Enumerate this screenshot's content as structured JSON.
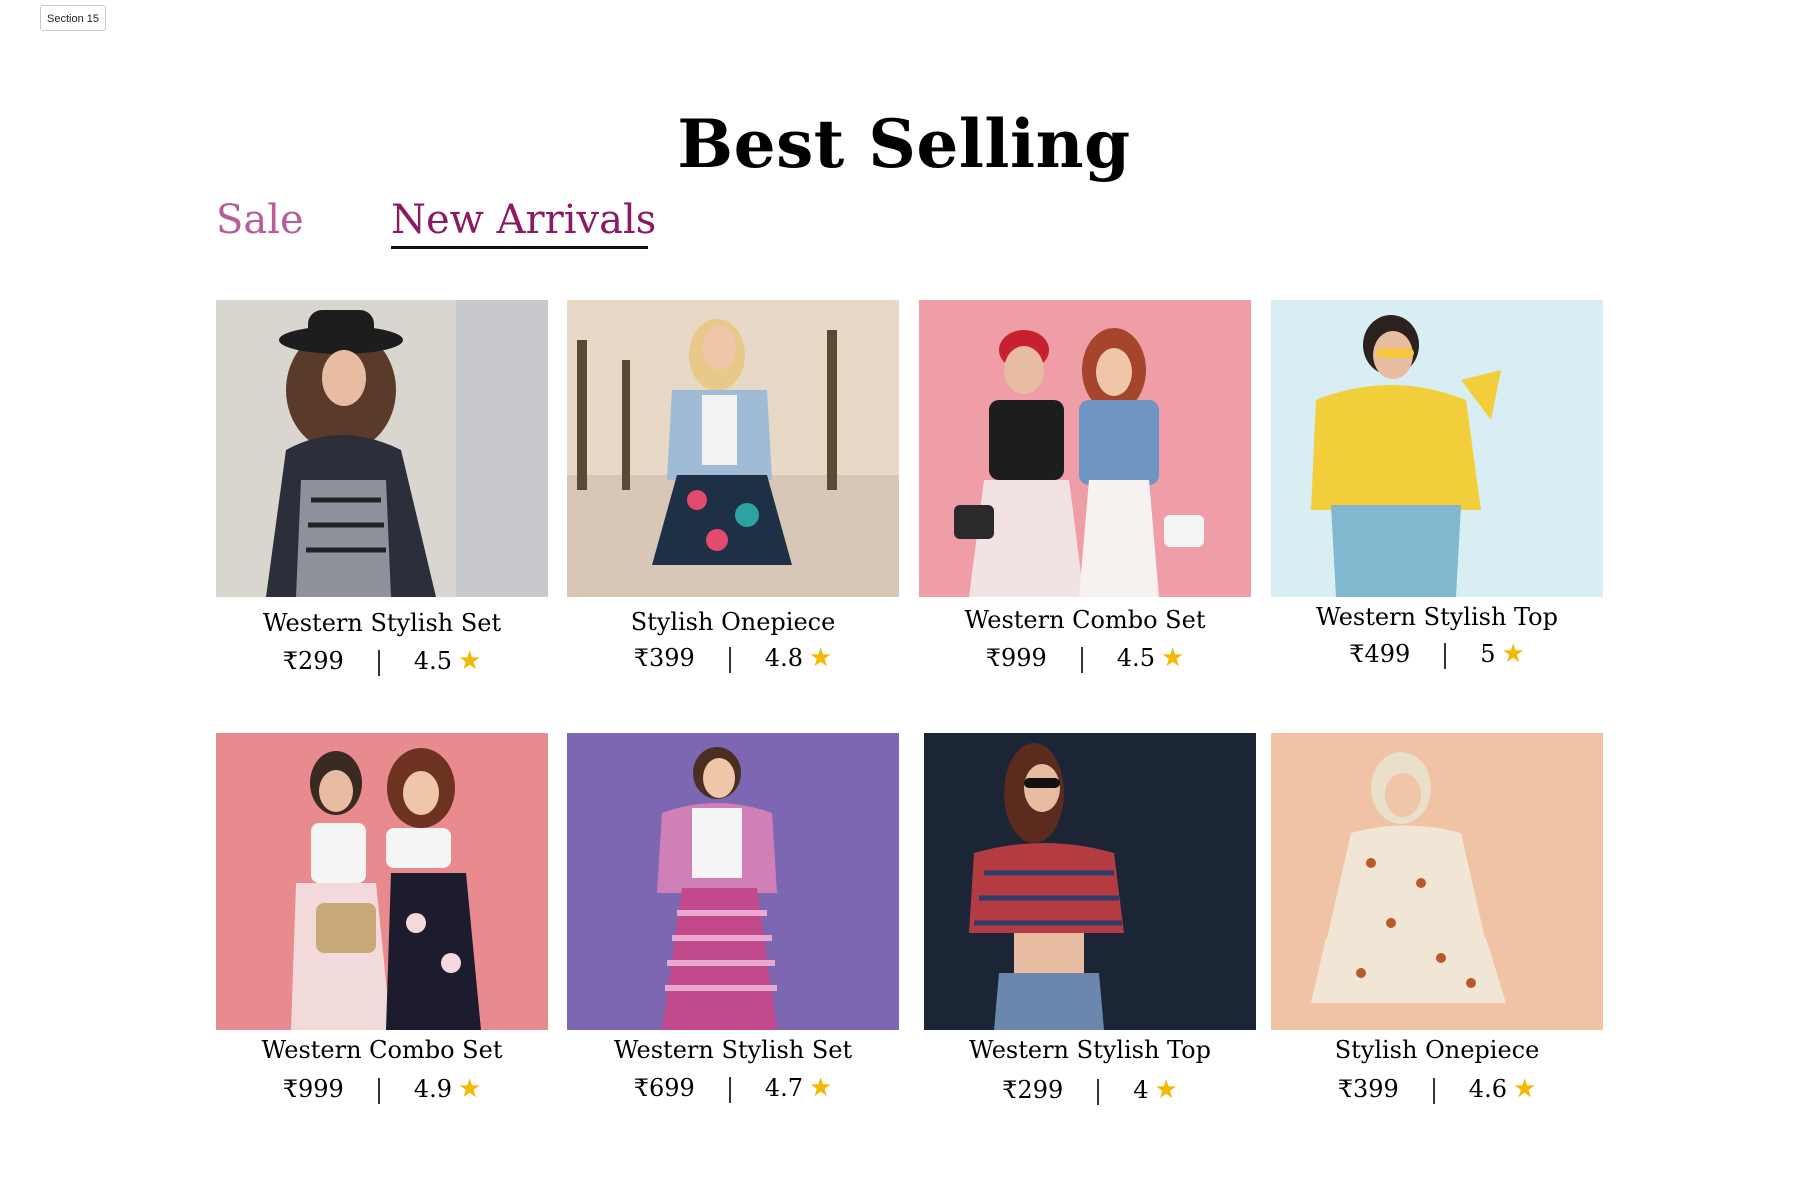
{
  "section_label": "Section 15",
  "page": {
    "title": "Best Selling"
  },
  "tabs": [
    {
      "label": "Sale",
      "active": false
    },
    {
      "label": "New Arrivals",
      "active": true
    }
  ],
  "colors": {
    "tab_inactive": "#b75e98",
    "tab_active": "#8b1a63",
    "star": "#f5b800"
  },
  "products": [
    {
      "name": "Western Stylish Set",
      "price": "₹299",
      "rating": "4.5",
      "icon": "star-icon",
      "bg": "#d9d5cf"
    },
    {
      "name": "Stylish Onepiece",
      "price": "₹399",
      "rating": "4.8",
      "icon": "star-icon",
      "bg": "#e8d8c6"
    },
    {
      "name": "Western Combo Set",
      "price": "₹999",
      "rating": "4.5",
      "icon": "star-icon",
      "bg": "#ef9ea8"
    },
    {
      "name": "Western Stylish Top",
      "price": "₹499",
      "rating": "5",
      "icon": "star-icon",
      "bg": "#d8eef2"
    },
    {
      "name": "Western Combo Set",
      "price": "₹999",
      "rating": "4.9",
      "icon": "star-icon",
      "bg": "#e98a8f"
    },
    {
      "name": "Western Stylish Set",
      "price": "₹699",
      "rating": "4.7",
      "icon": "star-icon",
      "bg": "#7d67b3"
    },
    {
      "name": "Western Stylish Top",
      "price": "₹299",
      "rating": "4",
      "icon": "star-icon",
      "bg": "#1b2535"
    },
    {
      "name": "Stylish Onepiece",
      "price": "₹399",
      "rating": "4.6",
      "icon": "star-icon",
      "bg": "#efc3a4"
    }
  ]
}
